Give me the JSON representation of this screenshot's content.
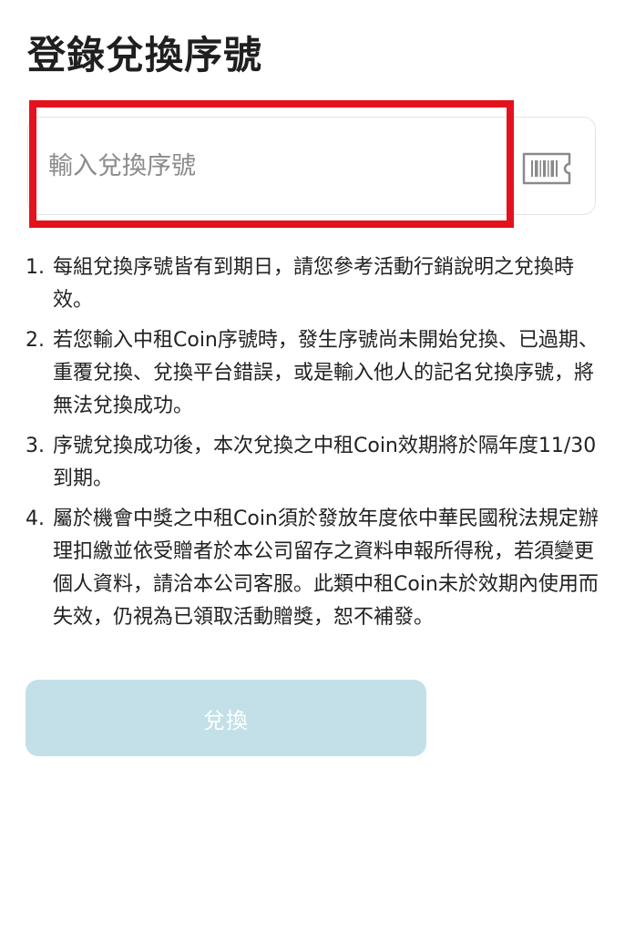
{
  "page": {
    "title": "登錄兌換序號"
  },
  "serial_input": {
    "placeholder": "輸入兌換序號",
    "value": "",
    "scan_icon": "barcode-ticket-icon"
  },
  "highlight": {
    "color": "#e4121d"
  },
  "notes": [
    {
      "num": "1.",
      "text": "每組兌換序號皆有到期日，請您參考活動行銷說明之兌換時效。"
    },
    {
      "num": "2.",
      "text": "若您輸入中租Coin序號時，發生序號尚未開始兌換、已過期、重覆兌換、兌換平台錯誤，或是輸入他人的記名兌換序號，將無法兌換成功。"
    },
    {
      "num": "3.",
      "text": "序號兌換成功後，本次兌換之中租Coin效期將於隔年度11/30到期。"
    },
    {
      "num": "4.",
      "text": "屬於機會中獎之中租Coin須於發放年度依中華民國稅法規定辦理扣繳並依受贈者於本公司留存之資料申報所得稅，若須變更個人資料，請洽本公司客服。此類中租Coin未於效期內使用而失效，仍視為已領取活動贈獎，恕不補發。"
    }
  ],
  "redeem_button": {
    "label": "兌換",
    "color": "#c3e0e8"
  }
}
